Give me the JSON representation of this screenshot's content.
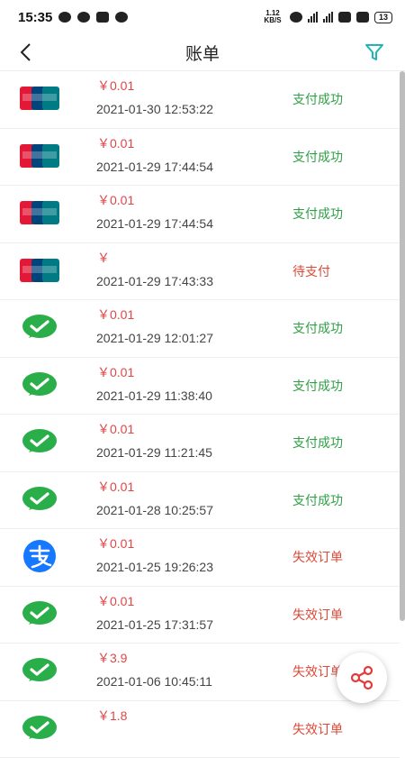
{
  "status_bar": {
    "time": "15:35",
    "net_speed": "1.12 KB/S",
    "battery": "13"
  },
  "header": {
    "title": "账单"
  },
  "bills": [
    {
      "method": "unionpay",
      "amount": "￥0.01",
      "time": "2021-01-30 12:53:22",
      "status": "支付成功",
      "kind": "ok"
    },
    {
      "method": "unionpay",
      "amount": "￥0.01",
      "time": "2021-01-29 17:44:54",
      "status": "支付成功",
      "kind": "ok"
    },
    {
      "method": "unionpay",
      "amount": "￥0.01",
      "time": "2021-01-29 17:44:54",
      "status": "支付成功",
      "kind": "ok"
    },
    {
      "method": "unionpay",
      "amount": "￥",
      "time": "2021-01-29 17:43:33",
      "status": "待支付",
      "kind": "pending"
    },
    {
      "method": "wechat",
      "amount": "￥0.01",
      "time": "2021-01-29 12:01:27",
      "status": "支付成功",
      "kind": "ok"
    },
    {
      "method": "wechat",
      "amount": "￥0.01",
      "time": "2021-01-29 11:38:40",
      "status": "支付成功",
      "kind": "ok"
    },
    {
      "method": "wechat",
      "amount": "￥0.01",
      "time": "2021-01-29 11:21:45",
      "status": "支付成功",
      "kind": "ok"
    },
    {
      "method": "wechat",
      "amount": "￥0.01",
      "time": "2021-01-28 10:25:57",
      "status": "支付成功",
      "kind": "ok"
    },
    {
      "method": "alipay",
      "amount": "￥0.01",
      "time": "2021-01-25 19:26:23",
      "status": "失效订单",
      "kind": "fail"
    },
    {
      "method": "wechat",
      "amount": "￥0.01",
      "time": "2021-01-25 17:31:57",
      "status": "失效订单",
      "kind": "fail"
    },
    {
      "method": "wechat",
      "amount": "￥3.9",
      "time": "2021-01-06 10:45:11",
      "status": "失效订单",
      "kind": "fail"
    },
    {
      "method": "wechat",
      "amount": "￥1.8",
      "time": "",
      "status": "失效订单",
      "kind": "fail"
    }
  ],
  "icons": {
    "back": "chevron-left-icon",
    "filter": "filter-icon",
    "share": "share-icon",
    "unionpay": "unionpay-logo-icon",
    "wechat": "wechat-pay-icon",
    "alipay": "alipay-icon"
  },
  "colors": {
    "success": "#2f9f45",
    "fail": "#d94a3a",
    "amount": "#e04646",
    "accent": "#1fb5b5"
  }
}
